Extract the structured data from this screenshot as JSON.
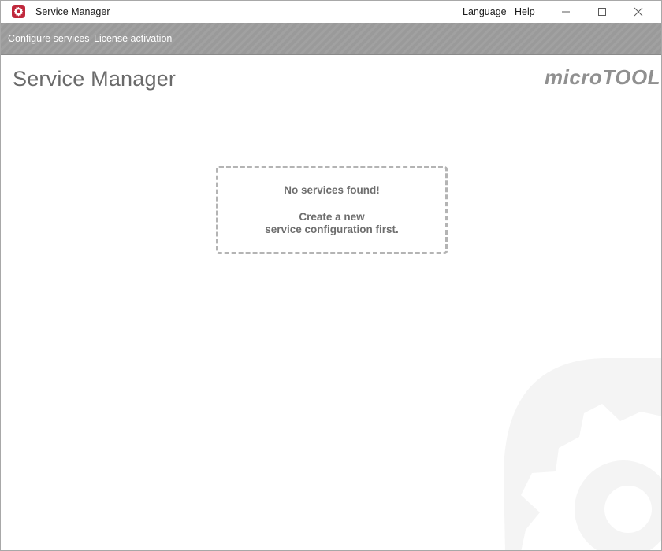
{
  "window": {
    "title": "Service Manager",
    "menu": {
      "language": "Language",
      "help": "Help"
    }
  },
  "toolbar": {
    "items": [
      {
        "label": "Configure services"
      },
      {
        "label": "License activation"
      }
    ]
  },
  "header": {
    "page_title": "Service Manager",
    "logo_part1": "micro",
    "logo_part2": "TOOL"
  },
  "empty_state": {
    "title": "No services found!",
    "line1": "Create a new",
    "line2": "service configuration first."
  },
  "icons": {
    "app": "gear-icon",
    "minimize": "minimize-icon",
    "maximize": "maximize-icon",
    "close": "close-icon",
    "watermark": "gear-watermark-icon"
  },
  "colors": {
    "accent": "#c0283c",
    "toolbar": "#9a9a9a",
    "title_text": "#6a6a6a",
    "dashed_border": "#b4b4b4"
  }
}
